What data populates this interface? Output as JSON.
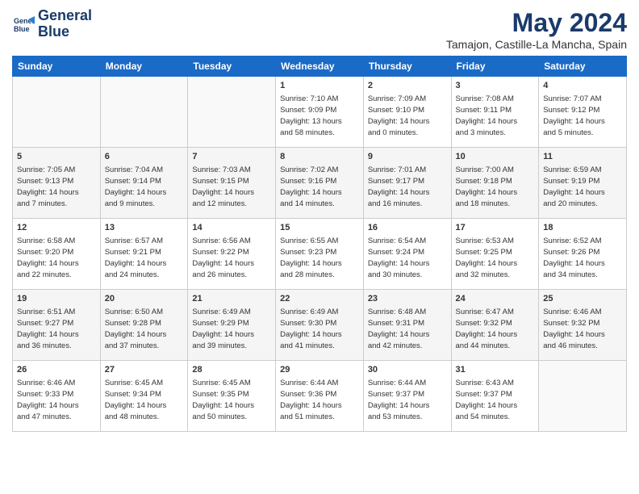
{
  "header": {
    "logo_line1": "General",
    "logo_line2": "Blue",
    "month": "May 2024",
    "location": "Tamajon, Castille-La Mancha, Spain"
  },
  "weekdays": [
    "Sunday",
    "Monday",
    "Tuesday",
    "Wednesday",
    "Thursday",
    "Friday",
    "Saturday"
  ],
  "weeks": [
    [
      {
        "day": "",
        "info": ""
      },
      {
        "day": "",
        "info": ""
      },
      {
        "day": "",
        "info": ""
      },
      {
        "day": "1",
        "info": "Sunrise: 7:10 AM\nSunset: 9:09 PM\nDaylight: 13 hours\nand 58 minutes."
      },
      {
        "day": "2",
        "info": "Sunrise: 7:09 AM\nSunset: 9:10 PM\nDaylight: 14 hours\nand 0 minutes."
      },
      {
        "day": "3",
        "info": "Sunrise: 7:08 AM\nSunset: 9:11 PM\nDaylight: 14 hours\nand 3 minutes."
      },
      {
        "day": "4",
        "info": "Sunrise: 7:07 AM\nSunset: 9:12 PM\nDaylight: 14 hours\nand 5 minutes."
      }
    ],
    [
      {
        "day": "5",
        "info": "Sunrise: 7:05 AM\nSunset: 9:13 PM\nDaylight: 14 hours\nand 7 minutes."
      },
      {
        "day": "6",
        "info": "Sunrise: 7:04 AM\nSunset: 9:14 PM\nDaylight: 14 hours\nand 9 minutes."
      },
      {
        "day": "7",
        "info": "Sunrise: 7:03 AM\nSunset: 9:15 PM\nDaylight: 14 hours\nand 12 minutes."
      },
      {
        "day": "8",
        "info": "Sunrise: 7:02 AM\nSunset: 9:16 PM\nDaylight: 14 hours\nand 14 minutes."
      },
      {
        "day": "9",
        "info": "Sunrise: 7:01 AM\nSunset: 9:17 PM\nDaylight: 14 hours\nand 16 minutes."
      },
      {
        "day": "10",
        "info": "Sunrise: 7:00 AM\nSunset: 9:18 PM\nDaylight: 14 hours\nand 18 minutes."
      },
      {
        "day": "11",
        "info": "Sunrise: 6:59 AM\nSunset: 9:19 PM\nDaylight: 14 hours\nand 20 minutes."
      }
    ],
    [
      {
        "day": "12",
        "info": "Sunrise: 6:58 AM\nSunset: 9:20 PM\nDaylight: 14 hours\nand 22 minutes."
      },
      {
        "day": "13",
        "info": "Sunrise: 6:57 AM\nSunset: 9:21 PM\nDaylight: 14 hours\nand 24 minutes."
      },
      {
        "day": "14",
        "info": "Sunrise: 6:56 AM\nSunset: 9:22 PM\nDaylight: 14 hours\nand 26 minutes."
      },
      {
        "day": "15",
        "info": "Sunrise: 6:55 AM\nSunset: 9:23 PM\nDaylight: 14 hours\nand 28 minutes."
      },
      {
        "day": "16",
        "info": "Sunrise: 6:54 AM\nSunset: 9:24 PM\nDaylight: 14 hours\nand 30 minutes."
      },
      {
        "day": "17",
        "info": "Sunrise: 6:53 AM\nSunset: 9:25 PM\nDaylight: 14 hours\nand 32 minutes."
      },
      {
        "day": "18",
        "info": "Sunrise: 6:52 AM\nSunset: 9:26 PM\nDaylight: 14 hours\nand 34 minutes."
      }
    ],
    [
      {
        "day": "19",
        "info": "Sunrise: 6:51 AM\nSunset: 9:27 PM\nDaylight: 14 hours\nand 36 minutes."
      },
      {
        "day": "20",
        "info": "Sunrise: 6:50 AM\nSunset: 9:28 PM\nDaylight: 14 hours\nand 37 minutes."
      },
      {
        "day": "21",
        "info": "Sunrise: 6:49 AM\nSunset: 9:29 PM\nDaylight: 14 hours\nand 39 minutes."
      },
      {
        "day": "22",
        "info": "Sunrise: 6:49 AM\nSunset: 9:30 PM\nDaylight: 14 hours\nand 41 minutes."
      },
      {
        "day": "23",
        "info": "Sunrise: 6:48 AM\nSunset: 9:31 PM\nDaylight: 14 hours\nand 42 minutes."
      },
      {
        "day": "24",
        "info": "Sunrise: 6:47 AM\nSunset: 9:32 PM\nDaylight: 14 hours\nand 44 minutes."
      },
      {
        "day": "25",
        "info": "Sunrise: 6:46 AM\nSunset: 9:32 PM\nDaylight: 14 hours\nand 46 minutes."
      }
    ],
    [
      {
        "day": "26",
        "info": "Sunrise: 6:46 AM\nSunset: 9:33 PM\nDaylight: 14 hours\nand 47 minutes."
      },
      {
        "day": "27",
        "info": "Sunrise: 6:45 AM\nSunset: 9:34 PM\nDaylight: 14 hours\nand 48 minutes."
      },
      {
        "day": "28",
        "info": "Sunrise: 6:45 AM\nSunset: 9:35 PM\nDaylight: 14 hours\nand 50 minutes."
      },
      {
        "day": "29",
        "info": "Sunrise: 6:44 AM\nSunset: 9:36 PM\nDaylight: 14 hours\nand 51 minutes."
      },
      {
        "day": "30",
        "info": "Sunrise: 6:44 AM\nSunset: 9:37 PM\nDaylight: 14 hours\nand 53 minutes."
      },
      {
        "day": "31",
        "info": "Sunrise: 6:43 AM\nSunset: 9:37 PM\nDaylight: 14 hours\nand 54 minutes."
      },
      {
        "day": "",
        "info": ""
      }
    ]
  ]
}
